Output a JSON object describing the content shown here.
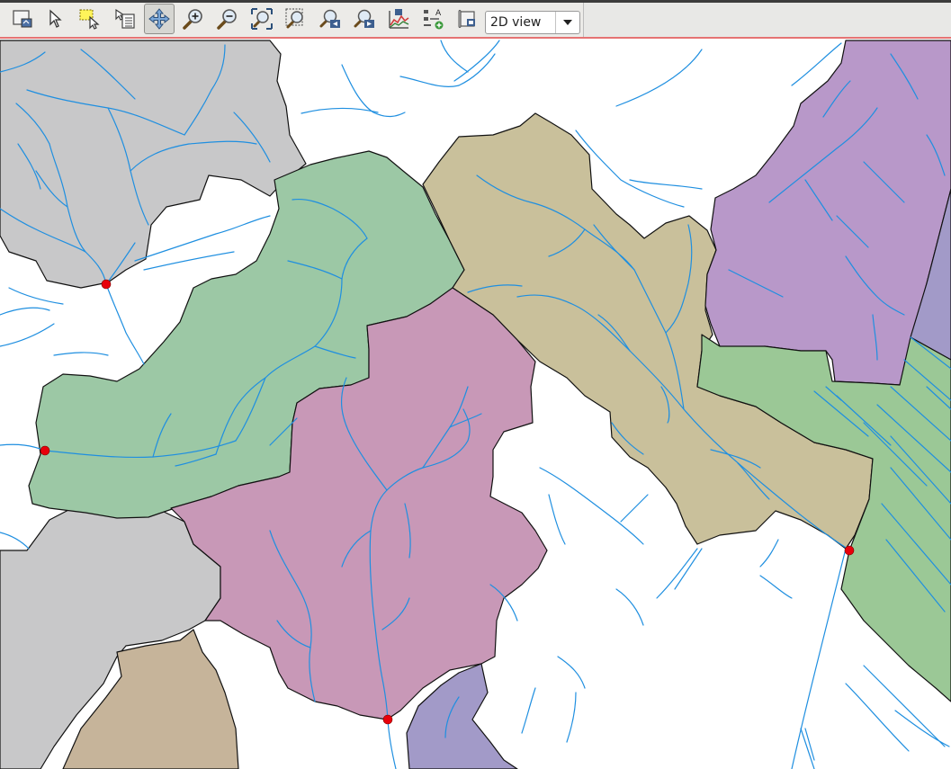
{
  "toolbar": {
    "buttons": [
      {
        "name": "new-map-view-button",
        "icon": "map-view-icon"
      },
      {
        "name": "select-button",
        "icon": "cursor-arrow-icon"
      },
      {
        "name": "select-rectangle-button",
        "icon": "select-rectangle-icon"
      },
      {
        "name": "identify-button",
        "icon": "identify-icon"
      },
      {
        "name": "pan-button",
        "icon": "pan-arrows-icon",
        "active": true
      },
      {
        "name": "zoom-in-button",
        "icon": "zoom-in-icon"
      },
      {
        "name": "zoom-out-button",
        "icon": "zoom-out-icon"
      },
      {
        "name": "zoom-full-button",
        "icon": "zoom-full-icon"
      },
      {
        "name": "zoom-selection-button",
        "icon": "zoom-selection-icon"
      },
      {
        "name": "zoom-last-button",
        "icon": "zoom-last-icon"
      },
      {
        "name": "zoom-next-button",
        "icon": "zoom-next-icon"
      },
      {
        "name": "profile-tool-button",
        "icon": "profile-chart-icon"
      },
      {
        "name": "legend-button",
        "icon": "legend-icon"
      },
      {
        "name": "layout-button",
        "icon": "print-layout-icon"
      }
    ],
    "view_select": {
      "value": "2D view",
      "arrow_icon": "chevron-down-icon"
    }
  },
  "colors": {
    "grey_basin": "#c8c8c9",
    "green_basin": "#9cc8a5",
    "tan_basin": "#c9c09b",
    "purple_basin": "#b898c9",
    "pink_basin": "#c898b7",
    "brown_basin": "#c6b49a",
    "blue_basin": "#a29ac8",
    "right_green": "#9bc896",
    "river": "#1f8fe0",
    "outlet": "#e8000b",
    "active_border": "#e57373"
  },
  "map": {
    "outlets": [
      {
        "name": "outlet-point-1"
      },
      {
        "name": "outlet-point-2"
      },
      {
        "name": "outlet-point-3"
      },
      {
        "name": "outlet-point-4"
      }
    ]
  }
}
